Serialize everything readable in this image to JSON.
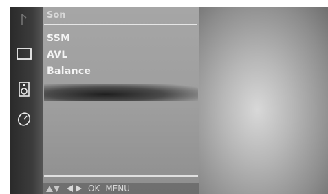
{
  "menu": {
    "title": "Son",
    "items": [
      "SSM",
      "AVL",
      "Balance"
    ]
  },
  "sidebar": {
    "icons": [
      "music-note-icon",
      "screen-icon",
      "speaker-icon",
      "clock-icon"
    ]
  },
  "nav_hints": {
    "ok_label": "OK",
    "menu_label": "MENU"
  }
}
